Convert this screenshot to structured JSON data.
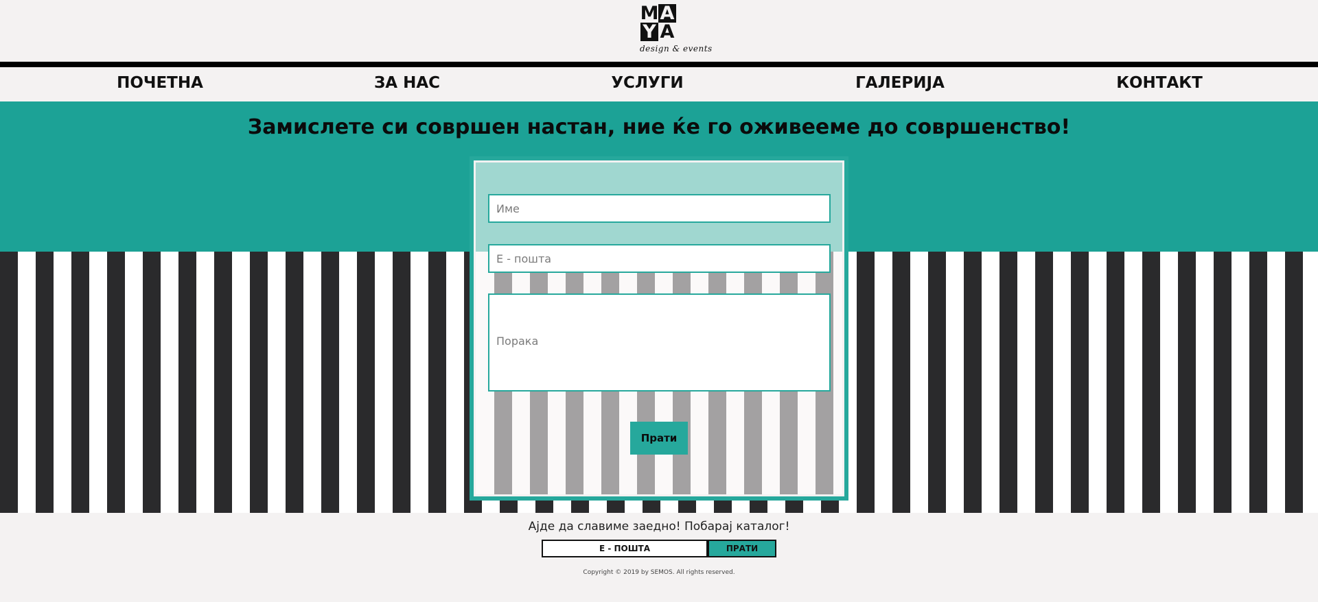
{
  "logo": {
    "letters": [
      "M",
      "A",
      "Y",
      "A"
    ],
    "tagline": "design & events"
  },
  "nav": {
    "items": [
      {
        "label": "ПОЧЕТНА"
      },
      {
        "label": "ЗА НАС"
      },
      {
        "label": "УСЛУГИ"
      },
      {
        "label": "ГАЛЕРИЈА"
      },
      {
        "label": "КОНТАКТ"
      }
    ]
  },
  "hero": {
    "title": "Замислете си совршен настан, ние ќе го оживееме до совршенство!"
  },
  "contact_form": {
    "name_placeholder": "Име",
    "email_placeholder": "Е - пошта",
    "message_placeholder": "Порака",
    "send_label": "Прати"
  },
  "footer": {
    "tagline": "Ајде да славиме заедно! Побарај каталог!",
    "newsletter_placeholder": "Е - ПОШТА",
    "newsletter_button": "ПРАТИ",
    "copyright": "Copyright © 2019 by SEMOS. All rights reserved."
  },
  "colors": {
    "accent": "#1ca296",
    "form_border": "#26a89c",
    "stripe_dark": "#2a2a2c",
    "background": "#f4f2f2"
  }
}
